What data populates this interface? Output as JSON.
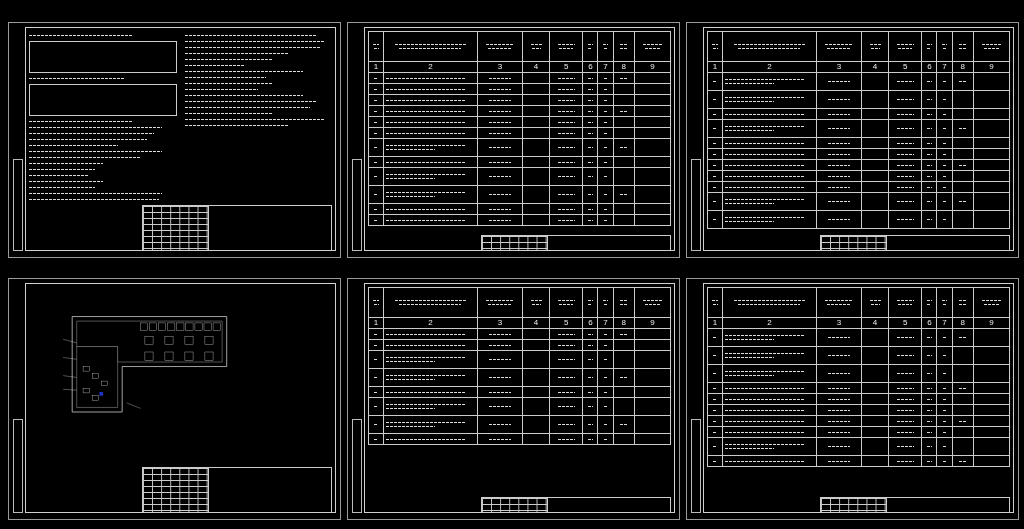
{
  "sheets": [
    {
      "kind": "notes"
    },
    {
      "kind": "spec",
      "column_numbers": [
        "1",
        "2",
        "3",
        "4",
        "5",
        "6",
        "7",
        "8",
        "9"
      ],
      "rows": [
        {
          "kind": "single"
        },
        {
          "kind": "single"
        },
        {
          "kind": "single"
        },
        {
          "kind": "single"
        },
        {
          "kind": "single"
        },
        {
          "kind": "single"
        },
        {
          "kind": "double"
        },
        {
          "kind": "single"
        },
        {
          "kind": "double"
        },
        {
          "kind": "double"
        },
        {
          "kind": "single"
        },
        {
          "kind": "single"
        }
      ]
    },
    {
      "kind": "spec",
      "column_numbers": [
        "1",
        "2",
        "3",
        "4",
        "5",
        "6",
        "7",
        "8",
        "9"
      ],
      "rows": [
        {
          "kind": "double"
        },
        {
          "kind": "double"
        },
        {
          "kind": "single"
        },
        {
          "kind": "double"
        },
        {
          "kind": "single"
        },
        {
          "kind": "single"
        },
        {
          "kind": "single"
        },
        {
          "kind": "single"
        },
        {
          "kind": "single"
        },
        {
          "kind": "double"
        },
        {
          "kind": "double"
        }
      ]
    },
    {
      "kind": "plan"
    },
    {
      "kind": "spec",
      "column_numbers": [
        "1",
        "2",
        "3",
        "4",
        "5",
        "6",
        "7",
        "8",
        "9"
      ],
      "rows": [
        {
          "kind": "single"
        },
        {
          "kind": "single"
        },
        {
          "kind": "double"
        },
        {
          "kind": "double"
        },
        {
          "kind": "single"
        },
        {
          "kind": "double"
        },
        {
          "kind": "double"
        },
        {
          "kind": "single"
        }
      ]
    },
    {
      "kind": "spec",
      "column_numbers": [
        "1",
        "2",
        "3",
        "4",
        "5",
        "6",
        "7",
        "8",
        "9"
      ],
      "rows": [
        {
          "kind": "double"
        },
        {
          "kind": "double"
        },
        {
          "kind": "double"
        },
        {
          "kind": "single"
        },
        {
          "kind": "single"
        },
        {
          "kind": "single"
        },
        {
          "kind": "single"
        },
        {
          "kind": "single"
        },
        {
          "kind": "double"
        },
        {
          "kind": "single"
        }
      ]
    }
  ]
}
